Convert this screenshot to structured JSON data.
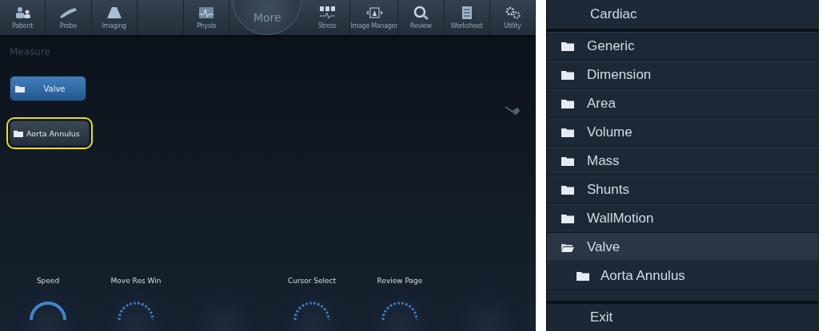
{
  "toolbar": {
    "items": [
      {
        "kind": "patient",
        "label": "Patient"
      },
      {
        "kind": "probe",
        "label": "Probe"
      },
      {
        "kind": "imaging",
        "label": "Imaging"
      },
      {
        "kind": "blank"
      },
      {
        "kind": "physio",
        "label": "Physio"
      },
      {
        "kind": "more",
        "label": "More"
      },
      {
        "kind": "stress",
        "label": "Stress"
      },
      {
        "kind": "image-manager",
        "label": "Image Manager"
      },
      {
        "kind": "review",
        "label": "Review"
      },
      {
        "kind": "worksheet",
        "label": "Worksheet"
      },
      {
        "kind": "utility",
        "label": "Utility"
      }
    ]
  },
  "measure": {
    "title": "Measure",
    "buttons": [
      {
        "label": "Valve",
        "selected": false,
        "kind": "primary"
      },
      {
        "label": "Aorta Annulus",
        "selected": true,
        "kind": "secondary"
      }
    ]
  },
  "knobs": [
    {
      "label": "Speed",
      "kind": "solid"
    },
    {
      "label": "Move Res Win",
      "kind": "dotted"
    },
    {
      "kind": "blank"
    },
    {
      "label": "Cursor Select",
      "kind": "dotted"
    },
    {
      "label": "Review Page",
      "kind": "dotted"
    },
    {
      "kind": "blank"
    }
  ],
  "menu": {
    "title": "Cardiac",
    "items": [
      {
        "label": "Generic",
        "expanded": false
      },
      {
        "label": "Dimension",
        "expanded": false
      },
      {
        "label": "Area",
        "expanded": false
      },
      {
        "label": "Volume",
        "expanded": false
      },
      {
        "label": "Mass",
        "expanded": false
      },
      {
        "label": "Shunts",
        "expanded": false
      },
      {
        "label": "WallMotion",
        "expanded": false
      },
      {
        "label": "Valve",
        "expanded": true,
        "children": [
          {
            "label": "Aorta Annulus",
            "expanded": false
          }
        ]
      }
    ],
    "exit": "Exit"
  }
}
